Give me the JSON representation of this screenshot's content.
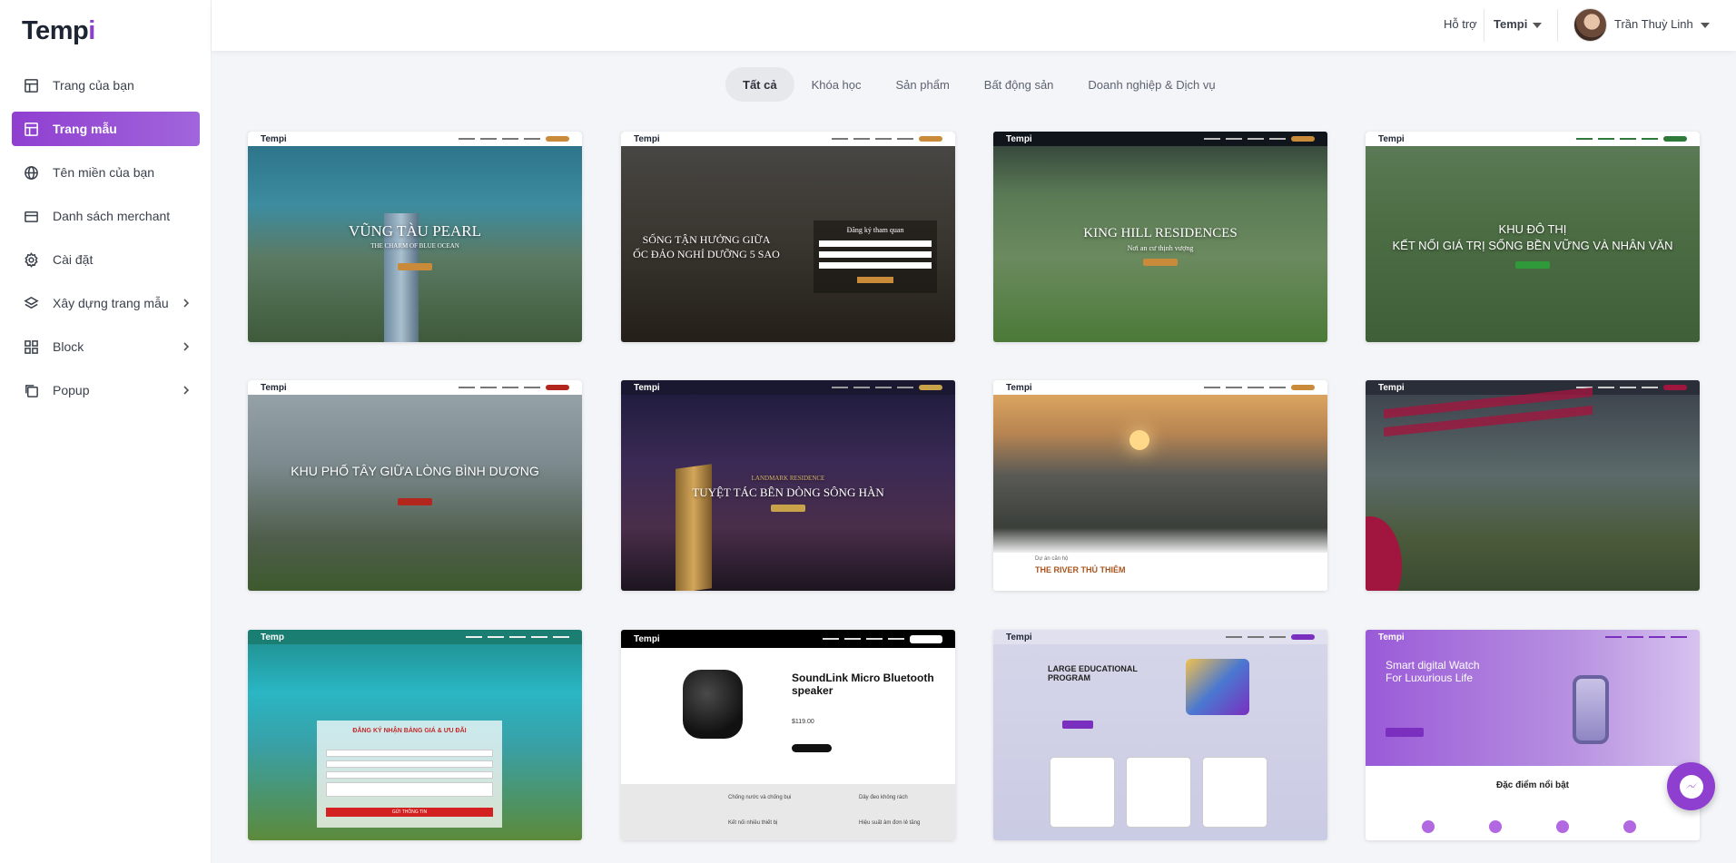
{
  "app": {
    "logo_main": "Temp",
    "logo_accent": "i"
  },
  "sidebar": {
    "items": [
      {
        "label": "Trang của bạn",
        "icon": "layout-icon"
      },
      {
        "label": "Trang mẫu",
        "icon": "template-icon",
        "active": true
      },
      {
        "label": "Tên miền của bạn",
        "icon": "globe-icon"
      },
      {
        "label": "Danh sách merchant",
        "icon": "card-icon"
      },
      {
        "label": "Cài đặt",
        "icon": "gear-icon"
      },
      {
        "label": "Xây dựng trang mẫu",
        "icon": "layers-icon",
        "has_children": true
      },
      {
        "label": "Block",
        "icon": "grid-icon",
        "has_children": true
      },
      {
        "label": "Popup",
        "icon": "copy-icon",
        "has_children": true
      }
    ]
  },
  "header": {
    "support": "Hỗ trợ",
    "org": "Tempi",
    "user_name": "Trần Thuỳ Linh"
  },
  "tabs": [
    "Tất cả",
    "Khóa học",
    "Sản phẩm",
    "Bất động sản",
    "Doanh nghiệp & Dịch vụ"
  ],
  "templates": [
    {
      "title": "VŨNG TÀU PEARL",
      "subtitle": "THE CHARM OF BLUE OCEAN",
      "brand": "Tempi"
    },
    {
      "title": "SỐNG TẬN HƯỞNG GIỮA",
      "title2": "ỐC ĐẢO NGHỈ DƯỠNG 5 SAO",
      "form_title": "Đăng ký tham quan",
      "brand": "Tempi"
    },
    {
      "title": "KING HILL RESIDENCES",
      "subtitle": "Nơi an cư thịnh vượng",
      "brand": "Tempi"
    },
    {
      "title": "KHU ĐÔ THỊ",
      "title2": "KẾT NỐI GIÁ TRỊ SỐNG BỀN VỮNG VÀ NHÂN VĂN",
      "brand": "Tempi"
    },
    {
      "title": "KHU PHỐ TÂY GIỮA LÒNG BÌNH DƯƠNG",
      "brand": "Tempi"
    },
    {
      "title": "TUYỆT TÁC BÊN DÒNG SÔNG HÀN",
      "subtitle": "LANDMARK RESIDENCE",
      "brand": "Tempi"
    },
    {
      "title": "THE RIVER THỦ THIÊM",
      "subtitle": "Dự án căn hộ",
      "brand": "Tempi"
    },
    {
      "title": "",
      "brand": "Tempi"
    },
    {
      "title": "ĐĂNG KÝ NHẬN BẢNG GIÁ & ƯU ĐÃI",
      "button": "GỬI THÔNG TIN",
      "brand": "Temp"
    },
    {
      "title": "SoundLink Micro Bluetooth speaker",
      "price": "$119.00",
      "features": [
        "Chống nước và chống bụi",
        "Dây đeo không rách",
        "Kết nối nhiều thiết bị",
        "Hiệu suất âm đơn lẻ tăng"
      ],
      "brand": "Tempi"
    },
    {
      "title": "LARGE EDUCATIONAL PROGRAM",
      "brand": "Tempi"
    },
    {
      "title": "Smart digital Watch For Luxurious Life",
      "section": "Đặc điểm nổi bật",
      "brand": "Tempi"
    }
  ],
  "colors": {
    "accent": "#8f3fd0",
    "tab_active_bg": "#e7e8ec"
  }
}
